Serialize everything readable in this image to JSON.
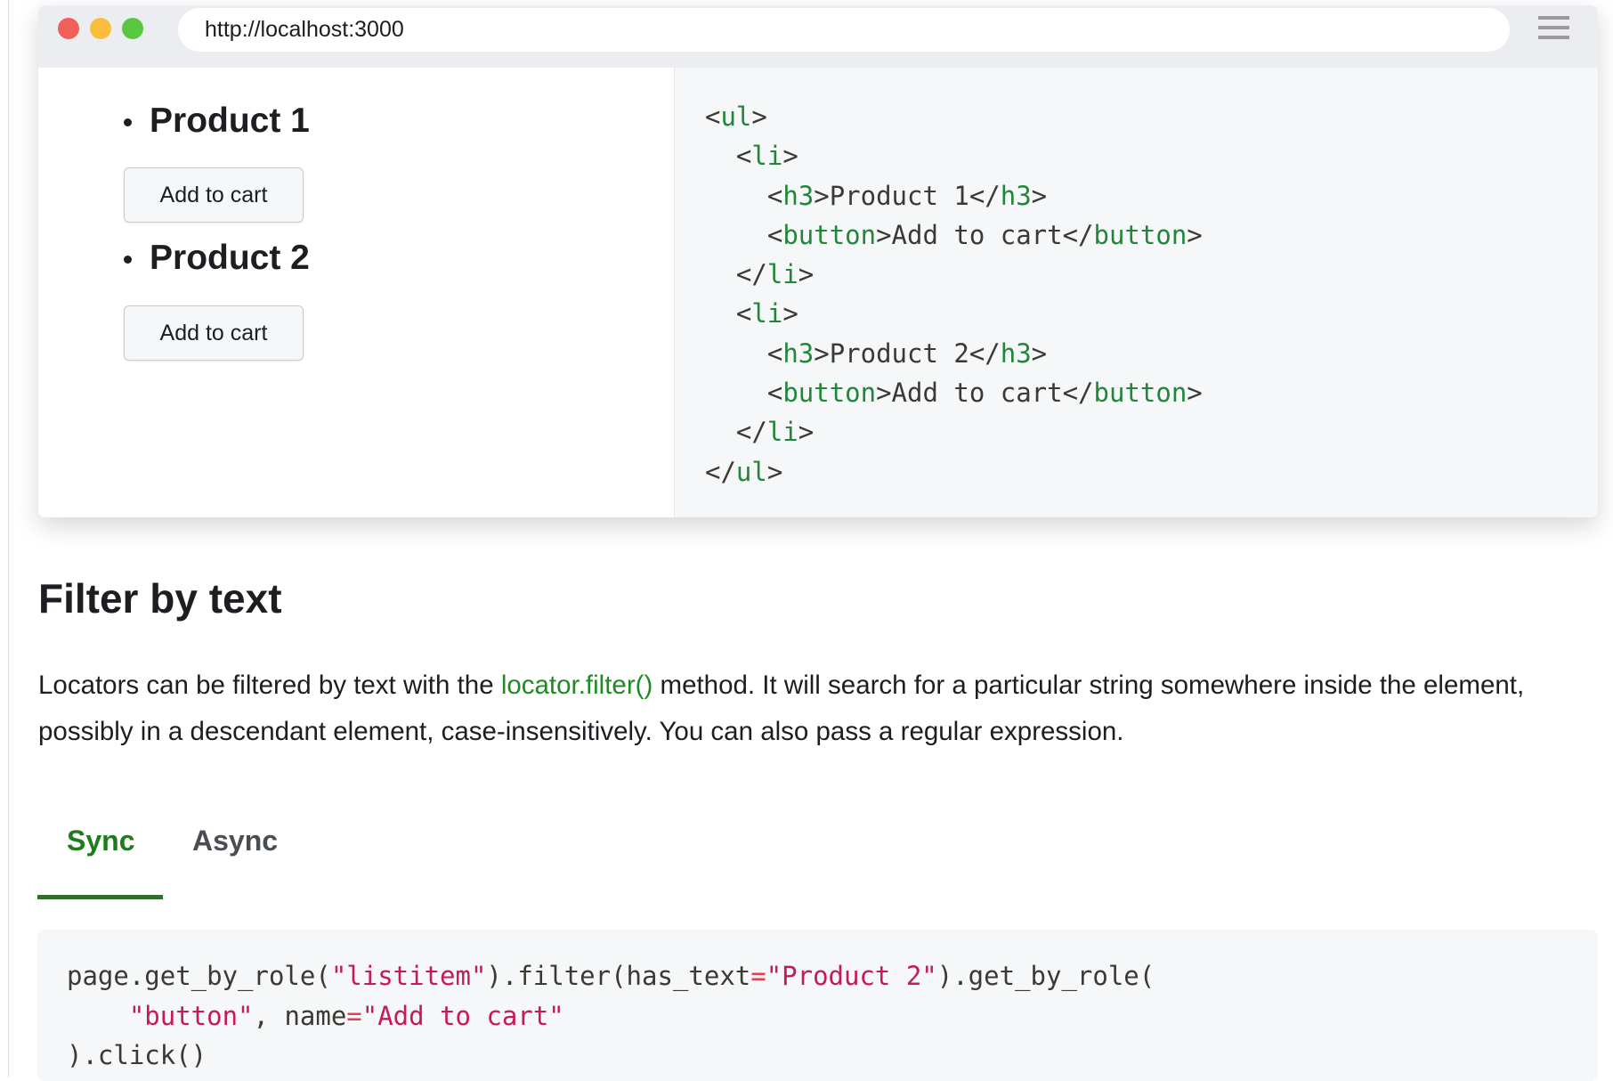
{
  "browser": {
    "url": "http://localhost:3000",
    "traffic_lights": {
      "close": "#f2605a",
      "minimize": "#fbbd3c",
      "maximize": "#58c840"
    }
  },
  "preview": {
    "products": [
      {
        "title": "Product 1",
        "button": "Add to cart"
      },
      {
        "title": "Product 2",
        "button": "Add to cart"
      }
    ]
  },
  "html_code": [
    [
      {
        "t": "<",
        "c": ""
      },
      {
        "t": "ul",
        "c": "tag"
      },
      {
        "t": ">",
        "c": ""
      }
    ],
    [
      {
        "t": "  <",
        "c": ""
      },
      {
        "t": "li",
        "c": "tag"
      },
      {
        "t": ">",
        "c": ""
      }
    ],
    [
      {
        "t": "    <",
        "c": ""
      },
      {
        "t": "h3",
        "c": "tag"
      },
      {
        "t": ">Product 1</",
        "c": ""
      },
      {
        "t": "h3",
        "c": "tag"
      },
      {
        "t": ">",
        "c": ""
      }
    ],
    [
      {
        "t": "    <",
        "c": ""
      },
      {
        "t": "button",
        "c": "tag"
      },
      {
        "t": ">Add to cart</",
        "c": ""
      },
      {
        "t": "button",
        "c": "tag"
      },
      {
        "t": ">",
        "c": ""
      }
    ],
    [
      {
        "t": "  </",
        "c": ""
      },
      {
        "t": "li",
        "c": "tag"
      },
      {
        "t": ">",
        "c": ""
      }
    ],
    [
      {
        "t": "  <",
        "c": ""
      },
      {
        "t": "li",
        "c": "tag"
      },
      {
        "t": ">",
        "c": ""
      }
    ],
    [
      {
        "t": "    <",
        "c": ""
      },
      {
        "t": "h3",
        "c": "tag"
      },
      {
        "t": ">Product 2</",
        "c": ""
      },
      {
        "t": "h3",
        "c": "tag"
      },
      {
        "t": ">",
        "c": ""
      }
    ],
    [
      {
        "t": "    <",
        "c": ""
      },
      {
        "t": "button",
        "c": "tag"
      },
      {
        "t": ">Add to cart</",
        "c": ""
      },
      {
        "t": "button",
        "c": "tag"
      },
      {
        "t": ">",
        "c": ""
      }
    ],
    [
      {
        "t": "  </",
        "c": ""
      },
      {
        "t": "li",
        "c": "tag"
      },
      {
        "t": ">",
        "c": ""
      }
    ],
    [
      {
        "t": "</",
        "c": ""
      },
      {
        "t": "ul",
        "c": "tag"
      },
      {
        "t": ">",
        "c": ""
      }
    ]
  ],
  "section": {
    "title": "Filter by text",
    "para_before": "Locators can be filtered by text with the ",
    "para_link": "locator.filter()",
    "para_after": " method. It will search for a particular string somewhere inside the element, possibly in a descendant element, case-insensitively. You can also pass a regular expression."
  },
  "tabs": [
    {
      "label": "Sync",
      "active": true
    },
    {
      "label": "Async",
      "active": false
    }
  ],
  "colors": {
    "accent": "#1d7d1d",
    "tab_inactive": "#4a4d52"
  },
  "python_code": [
    [
      {
        "t": "page.get_by_role(",
        "c": ""
      },
      {
        "t": "\"listitem\"",
        "c": "str"
      },
      {
        "t": ").filter(has_text",
        "c": ""
      },
      {
        "t": "=",
        "c": "op"
      },
      {
        "t": "\"Product 2\"",
        "c": "str"
      },
      {
        "t": ").get_by_role(",
        "c": ""
      }
    ],
    [
      {
        "t": "    ",
        "c": ""
      },
      {
        "t": "\"button\"",
        "c": "str"
      },
      {
        "t": ", name",
        "c": ""
      },
      {
        "t": "=",
        "c": "op"
      },
      {
        "t": "\"Add to cart\"",
        "c": "str"
      }
    ],
    [
      {
        "t": ").click()",
        "c": ""
      }
    ]
  ]
}
